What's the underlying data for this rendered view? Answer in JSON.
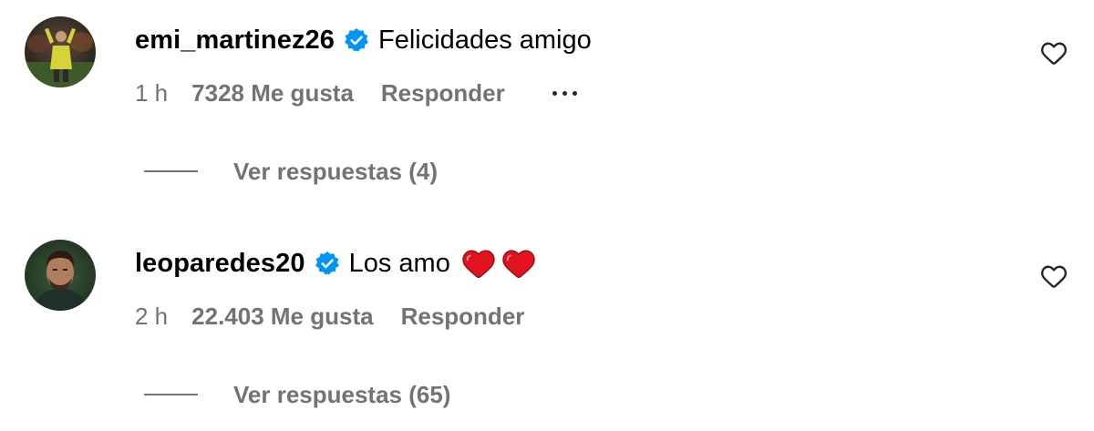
{
  "comments": [
    {
      "username": "emi_martinez26",
      "text": "Felicidades amigo",
      "time": "1 h",
      "likes": "7328 Me gusta",
      "reply_label": "Responder",
      "view_replies": "Ver respuestas (4)",
      "verified": true,
      "like_icon": "heart-outline-icon",
      "more_icon": "more-options-icon"
    },
    {
      "username": "leoparedes20",
      "text": "Los amo",
      "emoji": "❤️❤️",
      "time": "2 h",
      "likes": "22.403 Me gusta",
      "reply_label": "Responder",
      "view_replies": "Ver respuestas (65)",
      "verified": true,
      "like_icon": "heart-outline-icon"
    }
  ],
  "colors": {
    "verified_badge": "#0095F6",
    "secondary_text": "#737373",
    "primary_text": "#000000",
    "heart_emoji": "#E0131F"
  }
}
